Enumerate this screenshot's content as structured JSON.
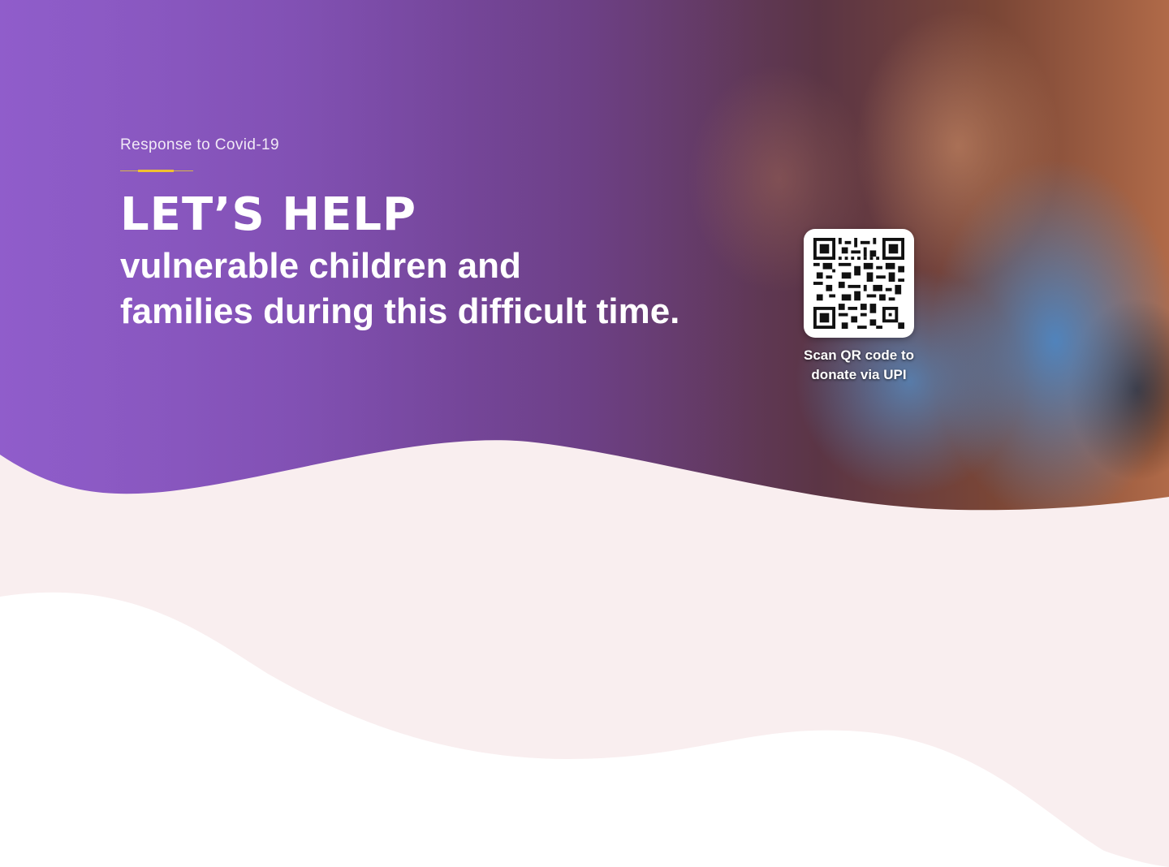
{
  "hero": {
    "eyebrow": "Response to Covid-19",
    "headline": "LET’S HELP",
    "subline_1": "vulnerable children and",
    "subline_2": "families during this difficult time.",
    "qr_caption_1": "Scan QR code to",
    "qr_caption_2": "donate via UPI"
  },
  "colors": {
    "accent_rule": "#f2c12e",
    "section_background": "#f9eeef",
    "hero_purple": "#8e5bc8"
  },
  "icons": {
    "qr_code": "qr-code-icon"
  }
}
